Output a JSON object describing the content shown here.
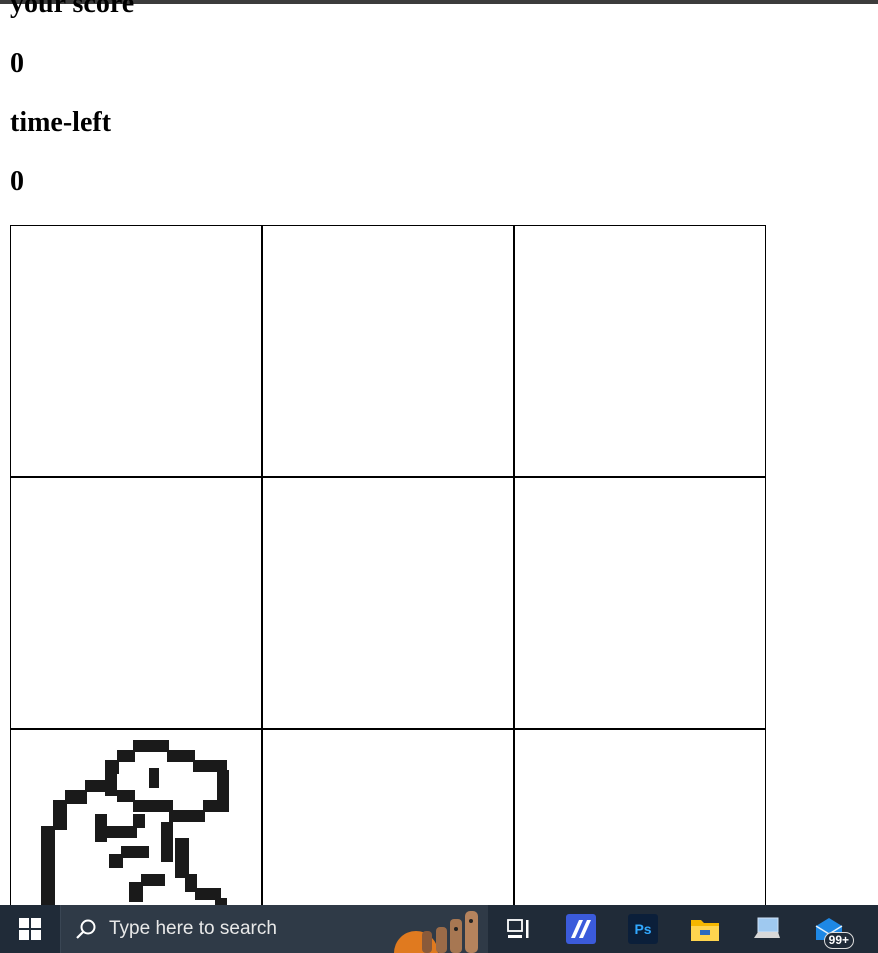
{
  "game": {
    "score_label": "your score",
    "score_value": "0",
    "time_label": "time-left",
    "time_value": "0",
    "mole_cell_index": 6
  },
  "taskbar": {
    "search_placeholder": "Type here to search",
    "notification_badge": "99+",
    "icons": [
      "windows-start-icon",
      "search-icon",
      "task-view-icon",
      "editor-app-icon",
      "photoshop-icon",
      "file-explorer-icon",
      "laptop-icon",
      "mail-icon"
    ],
    "photoshop_label": "Ps"
  }
}
